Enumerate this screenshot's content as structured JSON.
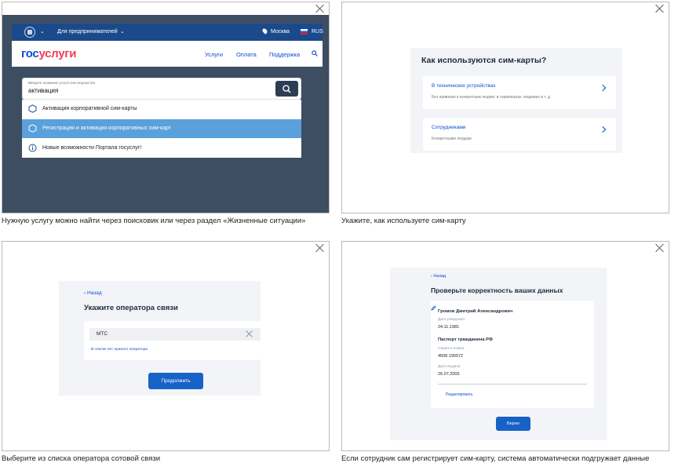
{
  "panel1": {
    "topbar": {
      "entrepreneurs": "Для предпринимателей",
      "city": "Москва",
      "lang": "RUS"
    },
    "logo": {
      "part1": "гос",
      "part2": "услуги"
    },
    "nav": [
      "Услуги",
      "Оплата",
      "Поддержка"
    ],
    "search": {
      "hint": "Введите название услуги или ведомства",
      "value": "активация"
    },
    "suggestions": [
      "Активация корпоративной сим-карты",
      "Регистрация и активация корпоративных сим-карт",
      "Новые возможности Портала госуслуг!"
    ],
    "caption": "Нужную услугу можно найти через поисковик или через раздел «Жизненные ситуации»"
  },
  "panel2": {
    "title": "Как используются сим-карты?",
    "options": [
      {
        "title": "В технических устройствах",
        "subtitle": "Без привязки к конкретным людям: в терминалах, модемах и т. д."
      },
      {
        "title": "Сотрудниками",
        "subtitle": "Конкретными людьми"
      }
    ],
    "caption": "Укажите, как используете сим-карту"
  },
  "panel3": {
    "back": "Назад",
    "title": "Укажите оператора связи",
    "operator_value": "МТС",
    "missing_link": "В списке нет нужного оператора",
    "continue": "Продолжить",
    "caption": "Выберите из списка оператора сотовой связи"
  },
  "panel4": {
    "back": "Назад",
    "title": "Проверьте корректность ваших данных",
    "name": "Громов Дмитрий Александрович",
    "birth_label": "Дата рождения",
    "birth_value": "24.11.1981",
    "passport_title": "Паспорт гражданина РФ",
    "series_label": "Серия и номер",
    "series_value": "4508 190572",
    "issue_label": "Дата выдачи",
    "issue_value": "26.07.2005",
    "edit": "Редактировать",
    "ok": "Верно",
    "caption": "Если сотрудник сам регистрирует сим-карту, система автоматически подгружает данные"
  }
}
